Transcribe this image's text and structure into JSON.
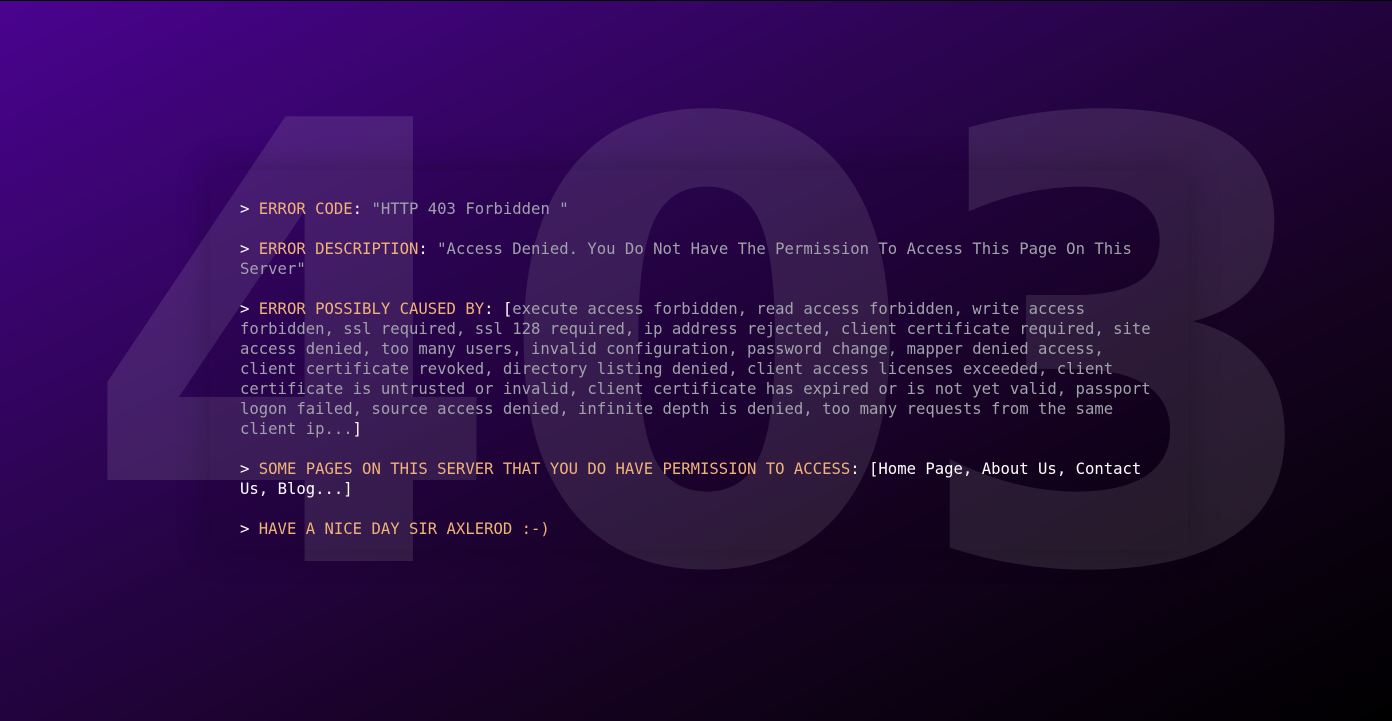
{
  "background_code": "403",
  "colors": {
    "key": "#f0b27a",
    "value": "#a0a2aa",
    "link": "#ffffff",
    "bg_start": "#4a0390",
    "bg_end": "#000000"
  },
  "terminal": {
    "prompt": ">",
    "error_code": {
      "label": "ERROR CODE",
      "value": "\"HTTP 403 Forbidden \""
    },
    "error_description": {
      "label": "ERROR DESCRIPTION",
      "value": "\"Access Denied. You Do Not Have The Permission To Access This Page On This Server\""
    },
    "possible_causes": {
      "label": "ERROR POSSIBLY CAUSED BY",
      "open": "[",
      "value": "execute access forbidden, read access forbidden, write access forbidden, ssl required, ssl 128 required, ip address rejected, client certificate required, site access denied, too many users, invalid configuration, password change, mapper denied access, client certificate revoked, directory listing denied, client access licenses exceeded, client certificate is untrusted or invalid, client certificate has expired or is not yet valid, passport logon failed, source access denied, infinite depth is denied, too many requests from the same client ip...",
      "close": "]"
    },
    "permitted_pages": {
      "label": "SOME PAGES ON THIS SERVER THAT YOU DO HAVE PERMISSION TO ACCESS",
      "open": "[",
      "links": [
        "Home Page",
        "About Us",
        "Contact Us",
        "Blog..."
      ],
      "close": "]"
    },
    "farewell": "HAVE A NICE DAY SIR AXLEROD :-)"
  }
}
